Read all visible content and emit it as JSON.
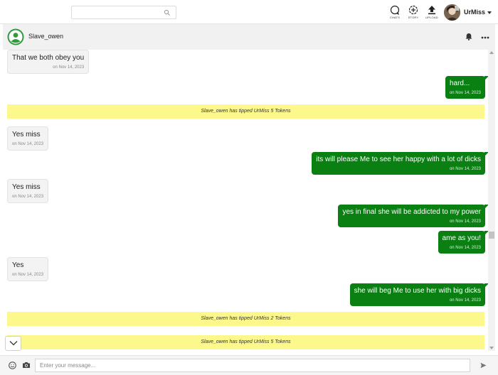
{
  "topbar": {
    "search_placeholder": "",
    "nav": [
      {
        "label": "CHATS",
        "icon": "chat-bubble-icon"
      },
      {
        "label": "STORY",
        "icon": "story-plus-icon"
      },
      {
        "label": "UPLOAD",
        "icon": "upload-icon"
      }
    ],
    "username": "UrMiss"
  },
  "chat": {
    "contact_name": "Slave_owen",
    "messages": [
      {
        "type": "in",
        "text": "That we both obey you",
        "date": "on Nov 14, 2023"
      },
      {
        "type": "out",
        "text": "hard...",
        "date": "on Nov 14, 2023"
      },
      {
        "type": "tip",
        "text": "Slave_owen has tipped UrMiss 5 Tokens"
      },
      {
        "type": "in",
        "text": "Yes miss",
        "date": "on Nov 14, 2023"
      },
      {
        "type": "out",
        "text": "its will please Me to see her happy with a lot of dicks",
        "date": "on Nov 14, 2023"
      },
      {
        "type": "in",
        "text": "Yes miss",
        "date": "on Nov 14, 2023"
      },
      {
        "type": "out",
        "text": "yes in final she will be addicted to my power",
        "date": "on Nov 14, 2023"
      },
      {
        "type": "out",
        "text": "ame as you!",
        "date": "on Nov 14, 2023"
      },
      {
        "type": "in",
        "text": "Yes",
        "date": "on Nov 14, 2023"
      },
      {
        "type": "out",
        "text": "she will beg Me to use her with big dicks",
        "date": "on Nov 14, 2023"
      },
      {
        "type": "tip",
        "text": "Slave_owen has tipped UrMiss 2 Tokens"
      },
      {
        "type": "tip",
        "text": "Slave_owen has tipped UrMiss 5 Tokens"
      }
    ]
  },
  "composer": {
    "placeholder": "Enter your message..."
  },
  "colors": {
    "outgoing_bubble": "#0a7f12",
    "tip_banner": "#fdf88c",
    "avatar_green": "#2e9b3c"
  }
}
